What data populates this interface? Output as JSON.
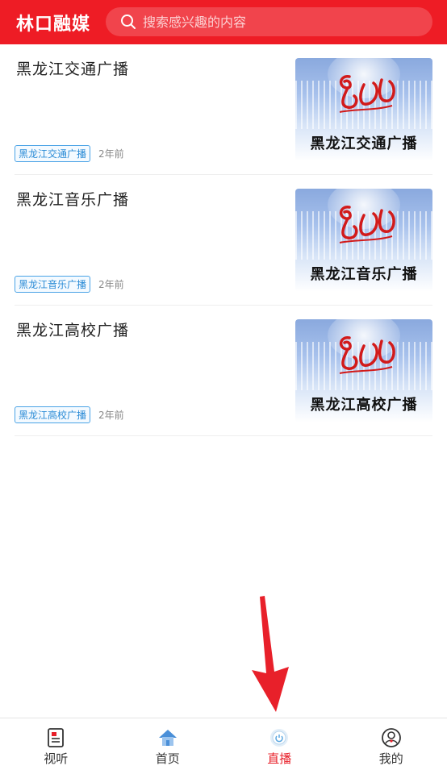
{
  "header": {
    "app_title": "林口融媒",
    "search_placeholder": "搜索感兴趣的内容"
  },
  "items": [
    {
      "title": "黑龙江交通广播",
      "tag": "黑龙江交通广播",
      "time": "2年前",
      "thumb_caption": "黑龙江交通广播"
    },
    {
      "title": "黑龙江音乐广播",
      "tag": "黑龙江音乐广播",
      "time": "2年前",
      "thumb_caption": "黑龙江音乐广播"
    },
    {
      "title": "黑龙江高校广播",
      "tag": "黑龙江高校广播",
      "time": "2年前",
      "thumb_caption": "黑龙江高校广播"
    }
  ],
  "nav": [
    {
      "label": "视听",
      "icon": "document-icon"
    },
    {
      "label": "首页",
      "icon": "home-icon"
    },
    {
      "label": "直播",
      "icon": "live-icon",
      "active": true
    },
    {
      "label": "我的",
      "icon": "profile-icon"
    }
  ],
  "colors": {
    "brand": "#ee1c25",
    "active": "#e8202a",
    "tag": "#2a8bd6"
  }
}
